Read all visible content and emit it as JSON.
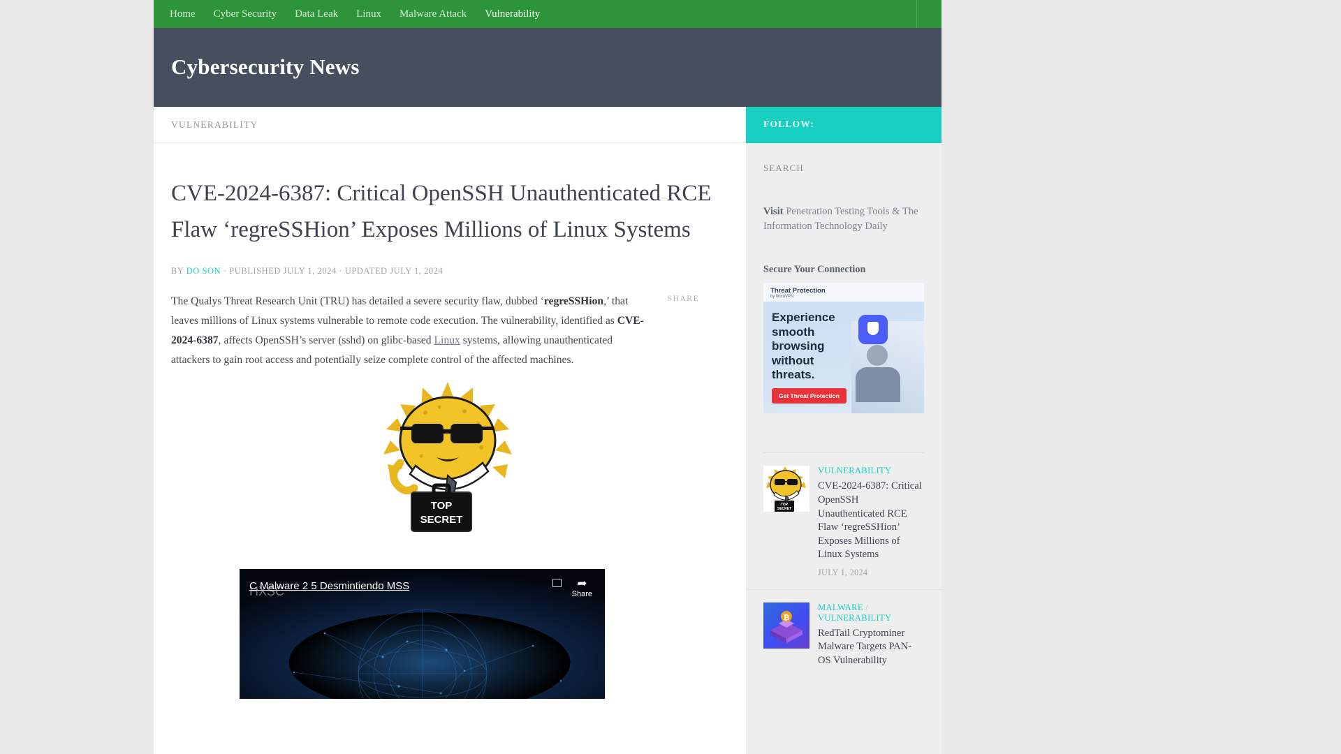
{
  "nav": {
    "items": [
      {
        "label": "Home",
        "active": false
      },
      {
        "label": "Cyber Security",
        "active": false
      },
      {
        "label": "Data Leak",
        "active": false
      },
      {
        "label": "Linux",
        "active": false
      },
      {
        "label": "Malware Attack",
        "active": false
      },
      {
        "label": "Vulnerability",
        "active": true
      }
    ]
  },
  "masthead": {
    "site_title": "Cybersecurity News"
  },
  "breadcrumb": {
    "category": "VULNERABILITY"
  },
  "sidebar": {
    "follow_heading": "FOLLOW:",
    "search_placeholder": "SEARCH",
    "visit": {
      "prefix": "Visit",
      "text": "Penetration Testing Tools & The Information Technology Daily"
    },
    "secure_heading": "Secure Your Connection",
    "ad": {
      "brand": "Threat Protection",
      "brand_sub": "by NordVPN",
      "headline": "Experience smooth browsing without threats.",
      "cta": "Get Threat Protection"
    },
    "posts": [
      {
        "category": "VULNERABILITY",
        "title": "CVE-2024-6387: Critical OpenSSH Unauthenticated RCE Flaw ‘regreSSHion’ Exposes Millions of Linux Systems",
        "date": "JULY 1, 2024"
      },
      {
        "category": "MALWARE / VULNERABILITY",
        "category_left": "MALWARE",
        "category_right": "VULNERABILITY",
        "title": "RedTail Cryptominer Malware Targets PAN-OS Vulnerability",
        "date": ""
      }
    ]
  },
  "article": {
    "title": "CVE-2024-6387: Critical OpenSSH Unauthenticated RCE Flaw ‘regreSSHion’ Exposes Millions of Linux Systems",
    "meta_by": "BY",
    "meta_author": "DO SON",
    "meta_published": "· PUBLISHED JULY 1, 2024 · UPDATED JULY 1, 2024",
    "share_label": "SHARE",
    "paragraph": {
      "p1": "The Qualys Threat Research Unit (TRU) has detailed a severe security flaw, dubbed ‘",
      "b1": "regreSSHion",
      "p2": ",’ that leaves millions of Linux systems vulnerable to remote code execution. The vulnerability, identified as ",
      "b2": "CVE-2024-6387",
      "p3": ", affects OpenSSH’s server (sshd) on glibc-based ",
      "link": "Linux",
      "p4": " systems, allowing unauthenticated attackers to gain root access and potentially seize complete control of the affected machines."
    },
    "figure_alt": "TOP SECRET",
    "video": {
      "title": "C Malware 2 5 Desmintiendo MSS",
      "brand": "HXSC",
      "share": "Share"
    }
  },
  "colors": {
    "nav_green": "#2d9439",
    "masthead_slate": "#474f5e",
    "accent_teal": "#19cfc1",
    "page_bg": "#e9e9e9"
  }
}
